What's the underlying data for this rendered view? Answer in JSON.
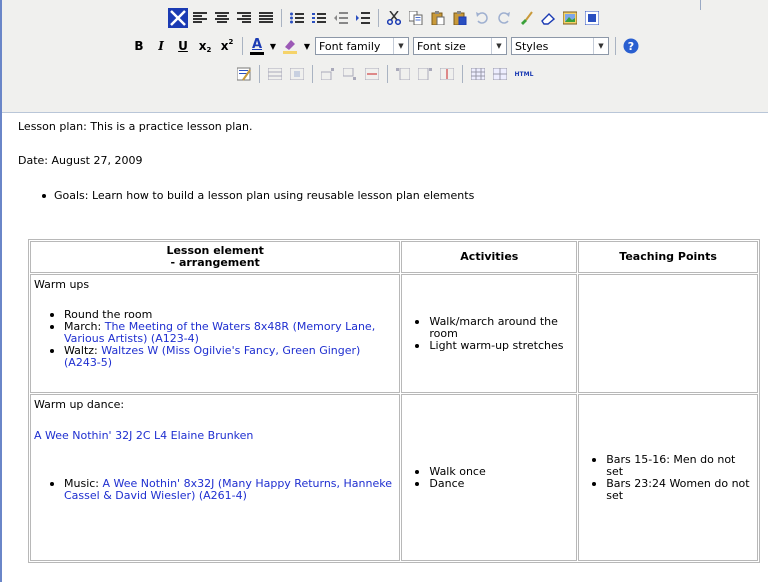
{
  "toolbar": {
    "font_family": "Font family",
    "font_size": "Font size",
    "styles": "Styles",
    "bold": "B",
    "italic": "I",
    "underline": "U",
    "subscript": "x",
    "superscript": "x",
    "text_color": "A",
    "html": "HTML"
  },
  "document": {
    "title_line": "Lesson plan: This is a practice lesson plan.",
    "date_line": "Date: August 27, 2009",
    "goals": "Goals: Learn how to build a lesson plan using reusable lesson plan elements",
    "table": {
      "headers": [
        "Lesson element",
        "- arrangement",
        "Activities",
        "Teaching Points"
      ],
      "row1": {
        "heading": "Warm ups",
        "items": [
          {
            "prefix": "Round the room",
            "link": ""
          },
          {
            "prefix": "March: ",
            "link": "The Meeting of the Waters 8x48R (Memory Lane, Various Artists) (A123-4)"
          },
          {
            "prefix": "Waltz: ",
            "link": "Waltzes W (Miss Ogilvie's Fancy, Green Ginger) (A243-5)"
          }
        ],
        "activities": [
          "Walk/march around the room",
          "Light warm-up stretches"
        ]
      },
      "row2": {
        "heading": "Warm up dance:",
        "dance_link": "A Wee Nothin' 32J 2C L4 Elaine Brunken",
        "music_prefix": "Music: ",
        "music_link": "A Wee Nothin' 8x32J (Many Happy Returns, Hanneke Cassel & David Wiesler) (A261-4)",
        "activities": [
          "Walk once",
          "Dance"
        ],
        "points": [
          "Bars 15-16: Men do not set",
          "Bars 23:24 Women do not set"
        ]
      }
    }
  },
  "colors": {
    "link": "#1f2fd0",
    "toolbar_bg": "#f0f0ee",
    "frame": "#6a86c8"
  }
}
